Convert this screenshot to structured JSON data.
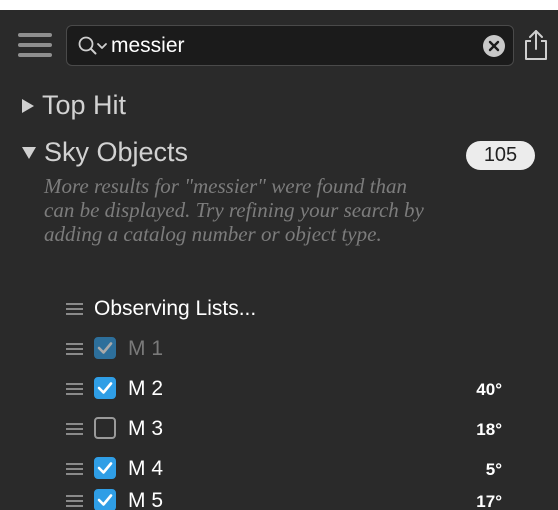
{
  "search": {
    "value": "messier"
  },
  "sections": {
    "top_hit": {
      "label": "Top Hit"
    },
    "sky_objects": {
      "label": "Sky Objects",
      "count": "105",
      "note": "More results for \"messier\" were found than can be displayed. Try refining your search by adding a catalog number or object type."
    }
  },
  "list": {
    "observing_lists_label": "Observing Lists...",
    "items": [
      {
        "name": "M 1",
        "checked": true,
        "dimmed": true,
        "altitude": ""
      },
      {
        "name": "M 2",
        "checked": true,
        "dimmed": false,
        "altitude": "40°"
      },
      {
        "name": "M 3",
        "checked": false,
        "dimmed": false,
        "altitude": "18°"
      },
      {
        "name": "M 4",
        "checked": true,
        "dimmed": false,
        "altitude": "5°"
      },
      {
        "name": "M 5",
        "checked": true,
        "dimmed": false,
        "altitude": "17°"
      }
    ]
  },
  "icons": {
    "menu": "hamburger-icon",
    "search": "magnifier-with-dropdown-icon",
    "clear": "clear-x-icon",
    "share": "share-icon",
    "drag": "drag-handle-icon",
    "check": "checkmark-icon"
  },
  "colors": {
    "background": "#2a2a2a",
    "checkbox_accent": "#2f9ee6",
    "note_text": "#7c7c7c",
    "badge_bg": "#ececec"
  }
}
